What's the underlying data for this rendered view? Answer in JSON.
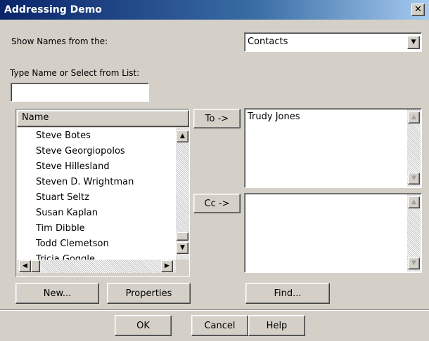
{
  "window": {
    "title": "Addressing Demo"
  },
  "show_names": {
    "label": "Show Names from the:",
    "selected": "Contacts"
  },
  "type_name": {
    "label": "Type Name or Select from List:",
    "value": ""
  },
  "name_list": {
    "header": "Name",
    "items": [
      "Steve Botes",
      "Steve Georgiopolos",
      "Steve Hillesland",
      "Steven D. Wrightman",
      "Stuart Seltz",
      "Susan Kaplan",
      "Tim Dibble",
      "Todd Clemetson",
      "Tricia Goggle"
    ]
  },
  "to": {
    "button": "To ->",
    "recipients": "Trudy Jones"
  },
  "cc": {
    "button": "Cc ->",
    "recipients": ""
  },
  "buttons": {
    "new": "New...",
    "properties": "Properties",
    "find": "Find...",
    "ok": "OK",
    "cancel": "Cancel",
    "help": "Help"
  },
  "icons": {
    "close": "close-icon",
    "dropdown": "chevron-down-icon"
  }
}
